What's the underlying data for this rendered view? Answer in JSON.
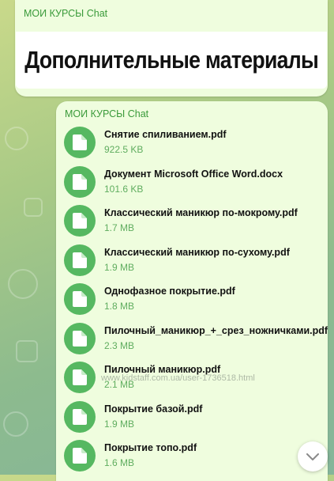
{
  "top_message": {
    "sender": "МОИ КУРСЫ Chat",
    "banner_title": "Дополнительные материалы"
  },
  "main_message": {
    "sender": "МОИ КУРСЫ Chat",
    "files": [
      {
        "name": "Снятие спиливанием.pdf",
        "size": "922.5 KB",
        "icon": "file-icon"
      },
      {
        "name": "Документ Microsoft Office Word.docx",
        "size": "101.6 KB",
        "icon": "file-icon"
      },
      {
        "name": "Классический маникюр по-мокрому.pdf",
        "size": "1.7 MB",
        "icon": "file-icon"
      },
      {
        "name": "Классический маникюр по-сухому.pdf",
        "size": "1.9 MB",
        "icon": "file-icon"
      },
      {
        "name": "Однофазное покрытие.pdf",
        "size": "1.8 MB",
        "icon": "file-icon"
      },
      {
        "name": "Пилочный_маникюр_+_срез_ножничками.pdf",
        "size": "2.3 MB",
        "icon": "file-icon"
      },
      {
        "name": "Пилочный маникюр.pdf",
        "size": "2.1 MB",
        "icon": "file-icon"
      },
      {
        "name": "Покрытие базой.pdf",
        "size": "1.9 MB",
        "icon": "file-icon"
      },
      {
        "name": "Покрытие топо.pdf",
        "size": "1.6 MB",
        "icon": "file-icon"
      }
    ]
  },
  "watermark": "www.kidstaff.com.ua/user-1736518.html",
  "colors": {
    "bubble": "#effdde",
    "accent_green": "#3a9a3a",
    "file_icon_bg": "#56b861",
    "size_text": "#5fad5f"
  },
  "scroll_button_icon": "chevron-down-icon"
}
